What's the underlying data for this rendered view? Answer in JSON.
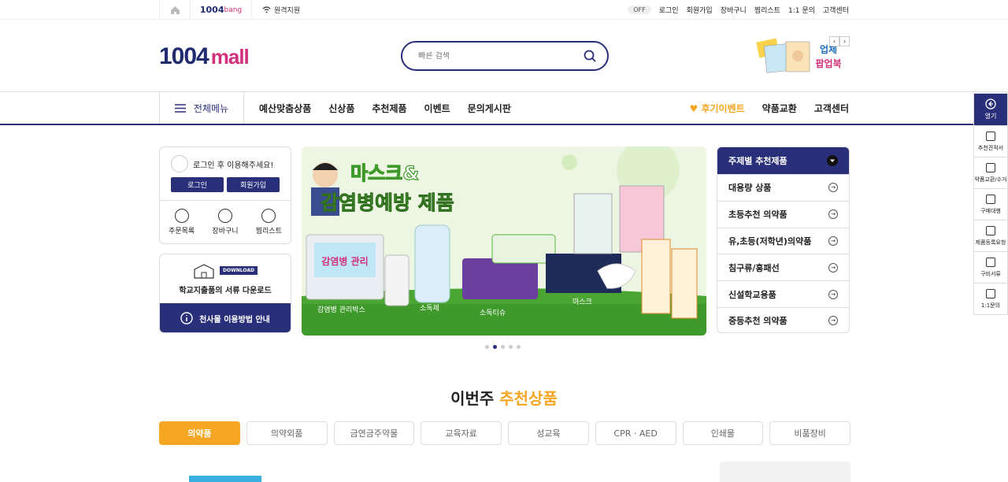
{
  "topbar": {
    "bang_logo": "1004",
    "bang_suffix": "bang",
    "remote_label": "원격지원",
    "toggle_label": "OFF",
    "links": [
      "로그인",
      "회원가입",
      "장바구니",
      "찜리스트",
      "1:1 문의",
      "고객센터"
    ]
  },
  "header": {
    "logo_main": "1004",
    "logo_sub": "mall",
    "search_placeholder": "빠른 검색",
    "banner_text": "업체 팝업북"
  },
  "nav": {
    "all_menu": "전체메뉴",
    "links": [
      "예산맞춤상품",
      "신상품",
      "추천제품",
      "이벤트",
      "문의게시판"
    ],
    "right": [
      "후기이벤트",
      "약품교환",
      "고객센터"
    ]
  },
  "login_box": {
    "message": "로그인 후 이용해주세요!",
    "login_btn": "로그인",
    "join_btn": "회원가입",
    "quick": [
      "주문목록",
      "장바구니",
      "찜리스트"
    ]
  },
  "download_box": {
    "badge": "DOWNLOAD",
    "title": "학교지출품의 서류 다운로드",
    "guide": "천사몰 이용방법 안내"
  },
  "hero": {
    "headline1": "마스크&",
    "headline2": "감염병예방 제품",
    "labels": [
      "감염병 관리박스",
      "소독제",
      "소독티슈",
      "마스크"
    ],
    "box_text": "감염병 관리"
  },
  "category": {
    "header": "주제별 추천제품",
    "items": [
      "대용량 상품",
      "초등추천 의약품",
      "유,초등(저학년)의약품",
      "침구류/홍패선",
      "신설학교용품",
      "중등추천 의약품"
    ]
  },
  "section": {
    "title_a": "이번주",
    "title_b": "추천상품",
    "tabs": [
      "의약품",
      "의약외품",
      "금연금주약물",
      "교육자료",
      "성교육",
      "CPR · AED",
      "인쇄물",
      "비품장비"
    ],
    "active_tab": 0
  },
  "sidebar": {
    "open": "열기",
    "items": [
      "추천견적서",
      "약품교환/수거",
      "구매대행",
      "제품등록요청",
      "구비서류",
      "1:1문의"
    ]
  }
}
